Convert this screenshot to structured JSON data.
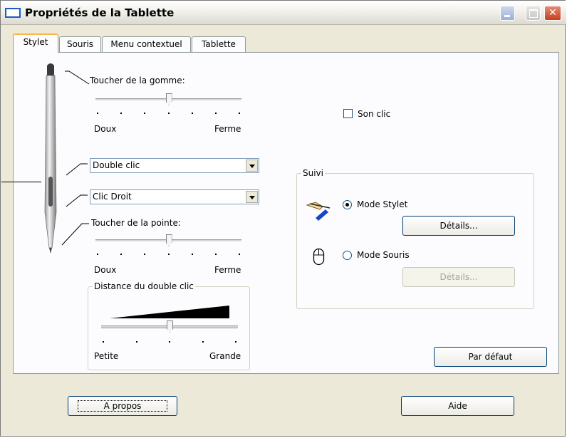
{
  "window": {
    "title": "Propriétés de la Tablette"
  },
  "tabs": [
    {
      "label": "Stylet",
      "active": true
    },
    {
      "label": "Souris",
      "active": false
    },
    {
      "label": "Menu contextuel",
      "active": false
    },
    {
      "label": "Tablette",
      "active": false
    }
  ],
  "eraser": {
    "label": "Toucher de la gomme:",
    "min_label": "Doux",
    "max_label": "Ferme",
    "level": 0.5
  },
  "button_upper": {
    "value": "Double clic"
  },
  "button_lower": {
    "value": "Clic Droit"
  },
  "tip": {
    "label": "Toucher de la pointe:",
    "min_label": "Doux",
    "max_label": "Ferme",
    "level": 0.5
  },
  "double_click": {
    "title": "Distance du double clic",
    "min_label": "Petite",
    "max_label": "Grande",
    "level": 0.5
  },
  "click_sound": {
    "label": "Son clic",
    "checked": false
  },
  "tracking": {
    "title": "Suivi",
    "stylus_mode": {
      "label": "Mode Stylet",
      "selected": true,
      "details_label": "Détails..."
    },
    "mouse_mode": {
      "label": "Mode Souris",
      "selected": false,
      "details_label": "Détails..."
    }
  },
  "defaults_button": "Par défaut",
  "footer": {
    "about_label": "A propos",
    "help_label": "Aide"
  },
  "icons": [
    "app-window-icon",
    "minimize-icon",
    "maximize-icon",
    "close-icon",
    "pen-icon",
    "stylus-hand-icon",
    "mouse-icon"
  ],
  "colors": {
    "close_button": "#c7401f",
    "focus_accent": "#f7b54a",
    "button_border": "#003c74"
  }
}
